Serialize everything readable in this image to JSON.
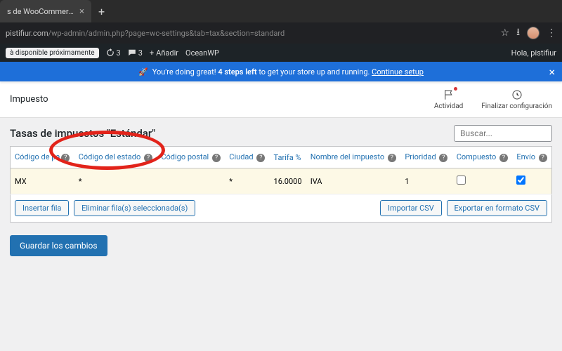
{
  "browser": {
    "tab_title": "s de WooCommerce ‹ ",
    "url_prefix": "pistifiur.com",
    "url_rest": "/wp-admin/admin.php?page=wc-settings&tab=tax&section=standard"
  },
  "wp_bar": {
    "coming_soon": "à disponible próximamente",
    "refresh_count": "3",
    "comment_count": "3",
    "add_label": "Añadir",
    "theme_label": "OceanWP",
    "greeting": "Hola, pistifiur"
  },
  "setup": {
    "text_a": "You're doing great!",
    "text_b": "4 steps left",
    "text_c": "to get your store up and running.",
    "link": "Continue setup"
  },
  "header": {
    "title": "Impuesto",
    "activity": "Actividad",
    "finalize": "Finalizar configuración"
  },
  "section": {
    "title": "Tasas de impuestos \"Estándar\"",
    "search_placeholder": "Buscar..."
  },
  "columns": {
    "country": "Código de pa",
    "state": "Código del estado",
    "postal": "Código postal",
    "city": "Ciudad",
    "rate": "Tarifa %",
    "name": "Nombre del impuesto",
    "priority": "Prioridad",
    "compound": "Compuesto",
    "shipping": "Envío"
  },
  "row": {
    "country": "MX",
    "state": "*",
    "postal": "",
    "city": "*",
    "rate": "16.0000",
    "name": "IVA",
    "priority": "1",
    "compound": false,
    "shipping": true
  },
  "actions": {
    "insert": "Insertar fila",
    "delete": "Eliminar fila(s) seleccionada(s)",
    "import": "Importar CSV",
    "export": "Exportar en formato CSV",
    "save": "Guardar los cambios"
  }
}
